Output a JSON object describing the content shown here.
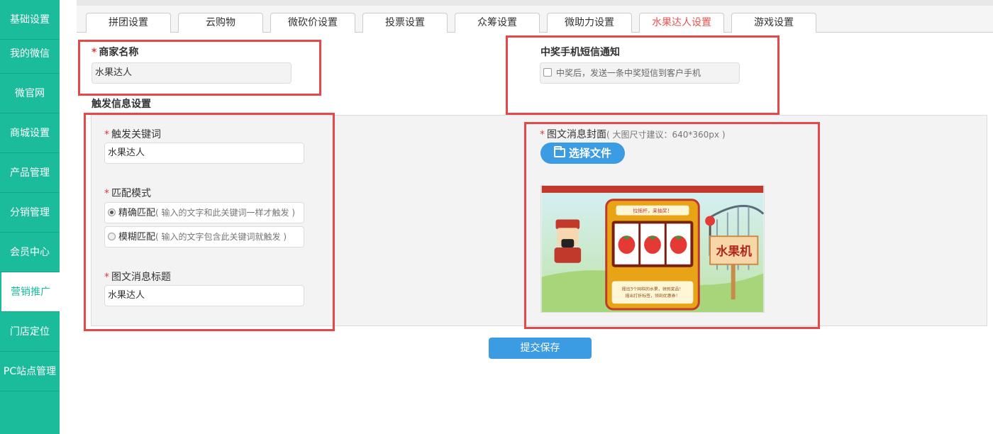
{
  "sidebar": {
    "items": [
      {
        "label": "基础设置"
      },
      {
        "label": "我的微信"
      },
      {
        "label": "微官网"
      },
      {
        "label": "商城设置"
      },
      {
        "label": "产品管理"
      },
      {
        "label": "分销管理"
      },
      {
        "label": "会员中心"
      },
      {
        "label": "营销推广"
      },
      {
        "label": "门店定位"
      },
      {
        "label": "PC站点管理"
      }
    ],
    "active_index": 7
  },
  "tabs": [
    {
      "label": "拼团设置"
    },
    {
      "label": "云购物"
    },
    {
      "label": "微砍价设置"
    },
    {
      "label": "投票设置"
    },
    {
      "label": "众筹设置"
    },
    {
      "label": "微助力设置"
    },
    {
      "label": "水果达人设置"
    },
    {
      "label": "游戏设置"
    }
  ],
  "active_tab_index": 6,
  "form": {
    "merchant_name": {
      "label": "商家名称",
      "value": "水果达人"
    },
    "sms_notify": {
      "label": "中奖手机短信通知",
      "option": "中奖后，发送一条中奖短信到客户手机",
      "checked": false
    },
    "trigger_section_title": "触发信息设置",
    "keyword": {
      "label": "触发关键词",
      "value": "水果达人"
    },
    "match_mode": {
      "label": "匹配模式",
      "options": [
        {
          "name": "精确匹配",
          "hint": "( 输入的文字和此关键词一样才触发 )",
          "selected": true
        },
        {
          "name": "模糊匹配",
          "hint": "( 输入的文字包含此关键词就触发 )",
          "selected": false
        }
      ]
    },
    "news_title": {
      "label": "图文消息标题",
      "value": "水果达人"
    },
    "cover": {
      "label": "图文消息封面",
      "hint": "( 大图尺寸建议：640*360px )",
      "button_label": "选择文件",
      "image_banner": "拉摇杆，来抽奖！",
      "image_sign": "水果机",
      "image_caption_1": "摇出3个同样的水果，领到奖品！",
      "image_caption_2": "摇出打折标签，领到优惠券！"
    },
    "submit_label": "提交保存"
  },
  "colors": {
    "sidebar_bg": "#1abc9c",
    "accent_blue": "#3b9be3",
    "required_star": "#e03a3a",
    "active_tab_text": "#e8534e",
    "highlight_box": "#e54848"
  }
}
